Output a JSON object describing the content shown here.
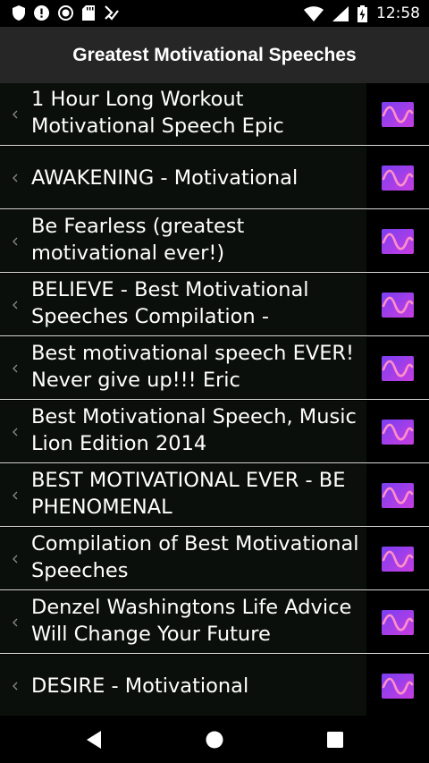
{
  "status": {
    "time": "12:58"
  },
  "appbar": {
    "title": "Greatest Motivational Speeches"
  },
  "colors": {
    "accent_gradient_start": "#7a3ff2",
    "accent_gradient_end": "#c73de0",
    "wave": "#ff8fc8"
  },
  "items": [
    {
      "title": "1 Hour Long Workout Motivational Speech Epic"
    },
    {
      "title": "AWAKENING - Motivational"
    },
    {
      "title": "Be Fearless (greatest motivational ever!)"
    },
    {
      "title": "BELIEVE - Best Motivational Speeches Compilation -"
    },
    {
      "title": "Best motivational speech EVER! Never give up!!! Eric"
    },
    {
      "title": "Best Motivational Speech, Music Lion Edition 2014"
    },
    {
      "title": "BEST MOTIVATIONAL EVER - BE PHENOMENAL"
    },
    {
      "title": "Compilation of Best Motivational Speeches"
    },
    {
      "title": "Denzel Washingtons Life Advice Will Change Your Future"
    },
    {
      "title": "DESIRE - Motivational"
    }
  ]
}
